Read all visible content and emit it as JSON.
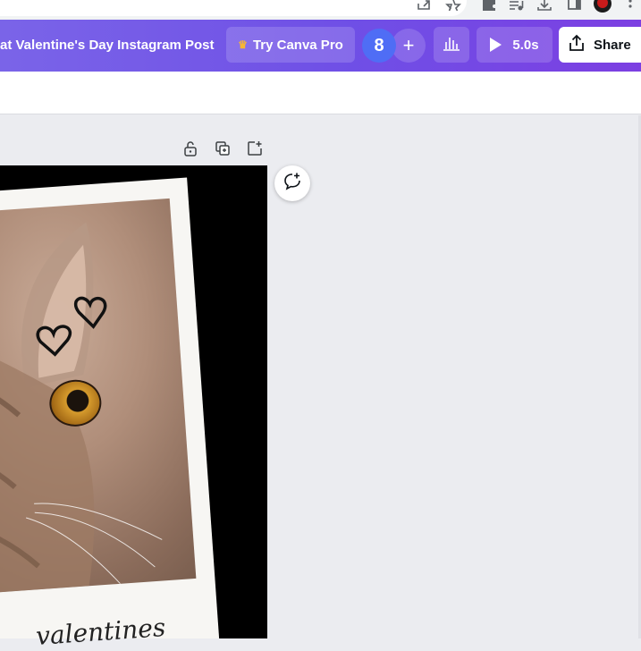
{
  "browser": {
    "icons": [
      "share-page-icon",
      "bookmark-star-icon",
      "extensions-puzzle-icon",
      "media-control-icon",
      "download-icon",
      "sidepanel-icon",
      "profile-avatar",
      "more-menu-icon"
    ]
  },
  "topbar": {
    "doc_title": "at Valentine's Day Instagram Post",
    "pro_label": "Try Canva Pro",
    "collaborator_count": "8",
    "add_label": "+",
    "play_label": "5.0s",
    "share_label": "Share",
    "gradient_colors": [
      "#7a64e8",
      "#6f4fe6",
      "#7c3fe2"
    ]
  },
  "canvas": {
    "page_tools": [
      "lock-icon",
      "duplicate-page-icon",
      "add-page-icon"
    ],
    "caption_text": "valentines",
    "comment_tool": "add-comment-icon"
  }
}
